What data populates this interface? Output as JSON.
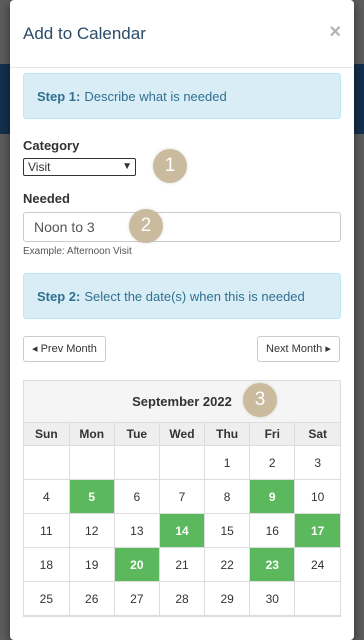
{
  "modal": {
    "title": "Add to Calendar",
    "close": "×"
  },
  "step1": {
    "bold": "Step 1:",
    "text": "Describe what is needed"
  },
  "category": {
    "label": "Category",
    "value": "Visit"
  },
  "needed": {
    "label": "Needed",
    "value": "Noon to 3",
    "help": "Example: Afternoon Visit"
  },
  "step2": {
    "bold": "Step 2:",
    "text": "Select the date(s) when this is needed"
  },
  "nav": {
    "prev": "Prev Month",
    "next": "Next Month"
  },
  "badges": [
    "1",
    "2",
    "3"
  ],
  "calendar": {
    "month": "September 2022",
    "weekdays": [
      "Sun",
      "Mon",
      "Tue",
      "Wed",
      "Thu",
      "Fri",
      "Sat"
    ],
    "weeks": [
      [
        "",
        "",
        "",
        "",
        "1",
        "2",
        "3"
      ],
      [
        "4",
        "5",
        "6",
        "7",
        "8",
        "9",
        "10"
      ],
      [
        "11",
        "12",
        "13",
        "14",
        "15",
        "16",
        "17"
      ],
      [
        "18",
        "19",
        "20",
        "21",
        "22",
        "23",
        "24"
      ],
      [
        "25",
        "26",
        "27",
        "28",
        "29",
        "30",
        ""
      ]
    ],
    "selected": [
      "5",
      "9",
      "14",
      "17",
      "20",
      "23"
    ],
    "selected_color": "#5cb85c"
  }
}
